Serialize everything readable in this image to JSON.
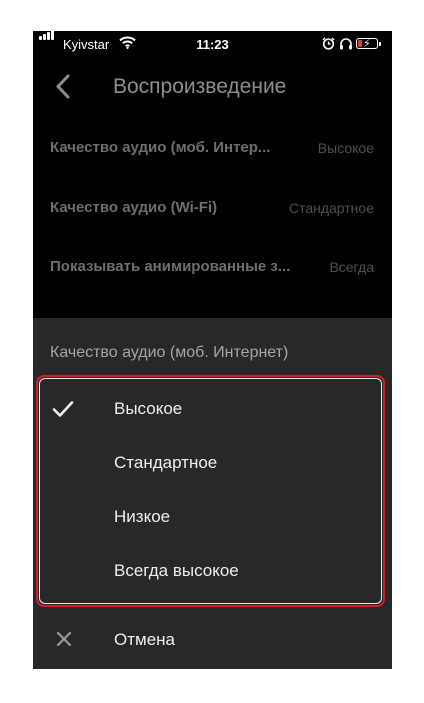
{
  "status_bar": {
    "carrier": "Kyivstar",
    "time": "11:23",
    "icons": [
      "signal-icon",
      "wifi-icon",
      "alarm-icon",
      "headphones-icon",
      "battery-charging-icon"
    ]
  },
  "header": {
    "title": "Воспроизведение",
    "back_icon": "chevron-left-icon"
  },
  "settings": [
    {
      "label": "Качество аудио (моб. Интер...",
      "value": "Высокое"
    },
    {
      "label": "Качество аудио (Wi-Fi)",
      "value": "Стандартное"
    },
    {
      "label": "Показывать анимированные з...",
      "value": "Всегда"
    }
  ],
  "sheet": {
    "title": "Качество аудио (моб. Интернет)",
    "options": [
      {
        "label": "Высокое",
        "selected": true
      },
      {
        "label": "Стандартное",
        "selected": false
      },
      {
        "label": "Низкое",
        "selected": false
      },
      {
        "label": "Всегда высокое",
        "selected": false
      }
    ],
    "cancel_label": "Отмена"
  },
  "colors": {
    "background": "#000000",
    "sheet": "#282828",
    "highlight_border": "#d0202d",
    "battery_low": "#e03b2f"
  }
}
